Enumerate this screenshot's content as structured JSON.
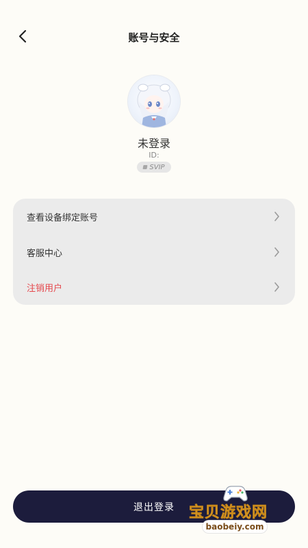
{
  "header": {
    "title": "账号与安全"
  },
  "profile": {
    "username": "未登录",
    "id_label": "ID:",
    "badge": "SVIP"
  },
  "menu": {
    "items": [
      {
        "label": "查看设备绑定账号",
        "danger": false
      },
      {
        "label": "客服中心",
        "danger": false
      },
      {
        "label": "注销用户",
        "danger": true
      }
    ]
  },
  "logout": {
    "label": "退出登录"
  },
  "watermark": {
    "text": "宝贝游戏网",
    "url": "baobeiy.com"
  },
  "colors": {
    "background": "#fdfcf7",
    "card": "#ebebeb",
    "danger": "#e5484d",
    "button": "#1c1c3c"
  },
  "icons": {
    "back": "chevron-left-icon",
    "menu_arrow": "chevron-right-icon",
    "watermark_logo": "gamepad-icon"
  }
}
